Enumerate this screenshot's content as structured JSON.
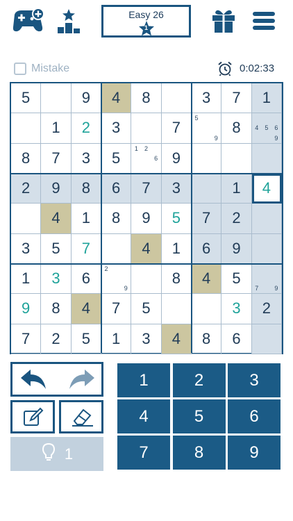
{
  "header": {
    "level_title": "Easy 26",
    "level_badge": "1",
    "icons": [
      "gamepad-plus-icon",
      "leaderboard-icon",
      "gift-icon",
      "menu-icon"
    ]
  },
  "status": {
    "mistake_label": "Mistake",
    "timer": "0:02:33"
  },
  "board": {
    "cells": [
      [
        "5",
        "",
        "9",
        "4",
        "8",
        "",
        "3",
        "7",
        "1"
      ],
      [
        "",
        "1",
        "2",
        "3",
        "",
        "7",
        "",
        "8",
        ""
      ],
      [
        "8",
        "7",
        "3",
        "5",
        "",
        "9",
        "",
        "",
        ""
      ],
      [
        "2",
        "9",
        "8",
        "6",
        "7",
        "3",
        "",
        "1",
        "4"
      ],
      [
        "",
        "4",
        "1",
        "8",
        "9",
        "5",
        "7",
        "2",
        ""
      ],
      [
        "3",
        "5",
        "7",
        "",
        "4",
        "1",
        "6",
        "9",
        ""
      ],
      [
        "1",
        "3",
        "6",
        "",
        "",
        "8",
        "4",
        "5",
        ""
      ],
      [
        "9",
        "8",
        "4",
        "7",
        "5",
        "",
        "",
        "3",
        "2"
      ],
      [
        "7",
        "2",
        "5",
        "1",
        "3",
        "4",
        "8",
        "6",
        ""
      ]
    ],
    "notes": [
      {
        "r": 1,
        "c": 6,
        "values": [
          "5",
          "",
          "",
          "",
          "",
          "",
          "",
          "",
          "9"
        ]
      },
      {
        "r": 1,
        "c": 8,
        "values": [
          "",
          "",
          "",
          "4",
          "5",
          "6",
          "",
          "",
          "9"
        ]
      },
      {
        "r": 2,
        "c": 4,
        "values": [
          "1",
          "2",
          "",
          "",
          "",
          "6",
          "",
          "",
          ""
        ]
      },
      {
        "r": 6,
        "c": 3,
        "values": [
          "2",
          "",
          "",
          "",
          "",
          "",
          "",
          "",
          "9"
        ]
      },
      {
        "r": 6,
        "c": 8,
        "values": [
          "",
          "",
          "",
          "",
          "",
          "",
          "7",
          "",
          "9"
        ]
      }
    ]
  },
  "numpad": {
    "keys": [
      "1",
      "2",
      "3",
      "4",
      "5",
      "6",
      "7",
      "8",
      "9"
    ]
  },
  "tools": {
    "hint_count": "1"
  },
  "colors": {
    "primary": "#1a5580",
    "highlight": "#d4dfe9",
    "same_number": "#ccc6a0",
    "user_entry": "#1fa39a",
    "hint_bg": "#c2d1de"
  }
}
